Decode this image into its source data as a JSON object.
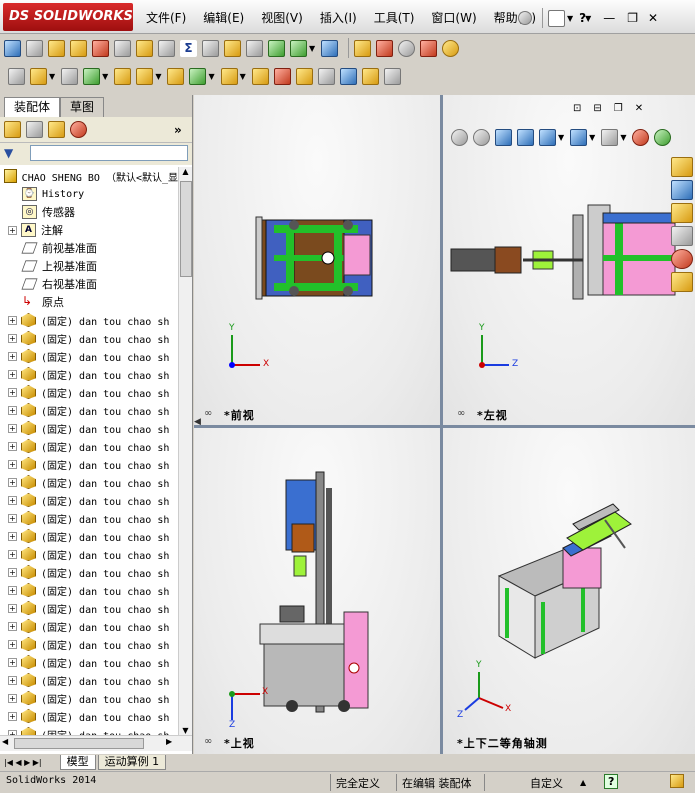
{
  "app": {
    "logo": "SOLIDWORKS",
    "logo_prefix": "DS"
  },
  "menus": [
    "文件(F)",
    "编辑(E)",
    "视图(V)",
    "插入(I)",
    "工具(T)",
    "窗口(W)",
    "帮助(H)"
  ],
  "window_buttons": [
    "minimize",
    "restore",
    "close"
  ],
  "left_pane": {
    "tabs": [
      "装配体",
      "草图"
    ],
    "active_tab": 0,
    "tree": {
      "root": "CHAO SHENG BO （默认<默认_显",
      "items": [
        {
          "label": "History",
          "icon": "history-icon"
        },
        {
          "label": "传感器",
          "icon": "sensor-icon"
        },
        {
          "label": "注解",
          "icon": "annotation-icon",
          "expandable": true
        },
        {
          "label": "前视基准面",
          "icon": "plane-icon"
        },
        {
          "label": "上视基准面",
          "icon": "plane-icon"
        },
        {
          "label": "右视基准面",
          "icon": "plane-icon"
        },
        {
          "label": "原点",
          "icon": "origin-icon"
        }
      ],
      "parts": [
        "(固定) dan tou chao sh",
        "(固定) dan tou chao sh",
        "(固定) dan tou chao sh",
        "(固定) dan tou chao sh",
        "(固定) dan tou chao sh",
        "(固定) dan tou chao sh",
        "(固定) dan tou chao sh",
        "(固定) dan tou chao sh",
        "(固定) dan tou chao sh",
        "(固定) dan tou chao sh",
        "(固定) dan tou chao sh",
        "(固定) dan tou chao sh",
        "(固定) dan tou chao sh",
        "(固定) dan tou chao sh",
        "(固定) dan tou chao sh",
        "(固定) dan tou chao sh",
        "(固定) dan tou chao sh",
        "(固定) dan tou chao sh",
        "(固定) dan tou chao sh",
        "(固定) dan tou chao sh",
        "(固定) dan tou chao sh",
        "(固定) dan tou chao sh",
        "(固定) dan tou chao sh",
        "(固定) dan tou chao sh"
      ]
    }
  },
  "bottom_tabs": [
    "模型",
    "运动算例 1"
  ],
  "status": {
    "app": "SolidWorks 2014",
    "defined": "完全定义",
    "editing": "在编辑 装配体",
    "units": "自定义",
    "help": "?"
  },
  "views": {
    "front": "*前视",
    "left": "*左视",
    "top": "*上视",
    "iso": "*上下二等角轴测"
  },
  "triad": {
    "x": "X",
    "y": "Y",
    "z": "Z"
  },
  "colors": {
    "brand": "#c41e1e",
    "frame_green": "#22c02a",
    "pink": "#f49ad4",
    "blue": "#3a6fd0",
    "brown": "#8a4a20",
    "gray": "#b8b8b8"
  }
}
